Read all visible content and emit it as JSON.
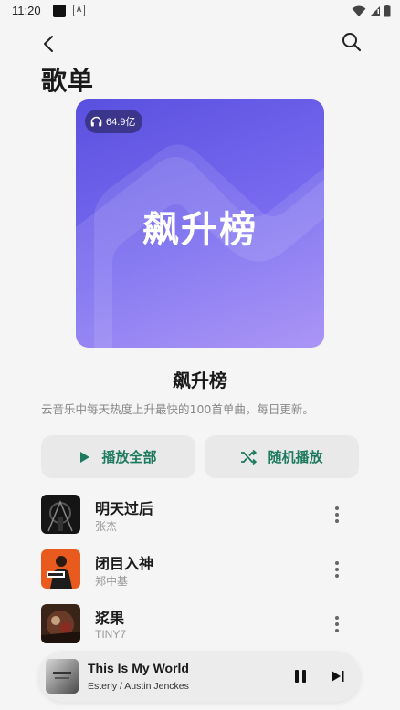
{
  "status_bar": {
    "time": "11:20",
    "notification_badge": "A"
  },
  "header": {
    "title": "歌单"
  },
  "playlist": {
    "cover_text": "飙升榜",
    "play_count": "64.9亿",
    "name": "飙升榜",
    "description": "云音乐中每天热度上升最快的100首单曲，每日更新。",
    "cover_gradient": [
      "#5a50e0",
      "#a28af5"
    ]
  },
  "actions": {
    "play_all_label": "播放全部",
    "shuffle_label": "随机播放",
    "accent_color": "#1e7a5e"
  },
  "tracks": [
    {
      "title": "明天过后",
      "artist": "张杰"
    },
    {
      "title": "闭目入神",
      "artist": "郑中基"
    },
    {
      "title": "浆果",
      "artist": "TINY7"
    }
  ],
  "now_playing": {
    "title": "This Is My World",
    "artist": "Esterly / Austin Jenckes"
  },
  "icons": {
    "back": "chevron-left-icon",
    "search": "search-icon",
    "headphones": "headphones-icon",
    "play": "play-icon",
    "shuffle": "shuffle-icon",
    "more": "more-vertical-icon",
    "pause": "pause-icon",
    "next": "skip-next-icon"
  }
}
